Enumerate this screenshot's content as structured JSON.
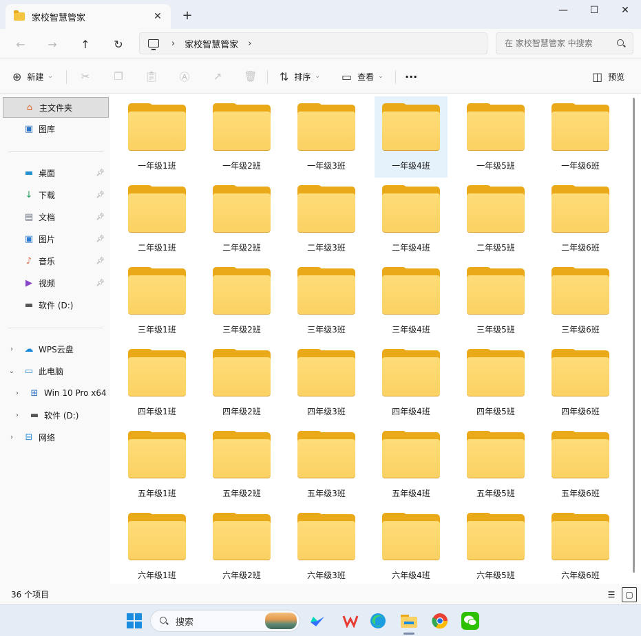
{
  "window": {
    "tab_title": "家校智慧管家",
    "new_tab": "+",
    "close_tab": "✕",
    "minimize": "—",
    "maximize": "☐",
    "close": "✕"
  },
  "navigation": {
    "back": "←",
    "forward": "→",
    "up": "↑",
    "refresh": "↻",
    "breadcrumb": [
      "家校智慧管家"
    ],
    "search_placeholder": "在 家校智慧管家 中搜索"
  },
  "toolbar": {
    "new_label": "新建",
    "sort_label": "排序",
    "view_label": "查看",
    "more_label": "···",
    "preview_label": "预览",
    "icons": [
      "cut-icon",
      "copy-icon",
      "paste-icon",
      "rename-icon",
      "share-icon",
      "delete-icon"
    ]
  },
  "sidebar": {
    "top_items": [
      {
        "label": "主文件夹",
        "icon": "home-icon",
        "selected": true
      },
      {
        "label": "图库",
        "icon": "gallery-icon"
      }
    ],
    "pinned_items": [
      {
        "label": "桌面",
        "icon": "desktop-icon",
        "pinned": true
      },
      {
        "label": "下载",
        "icon": "download-icon",
        "pinned": true
      },
      {
        "label": "文档",
        "icon": "document-icon",
        "pinned": true
      },
      {
        "label": "图片",
        "icon": "pictures-icon",
        "pinned": true
      },
      {
        "label": "音乐",
        "icon": "music-icon",
        "pinned": true
      },
      {
        "label": "视频",
        "icon": "video-icon",
        "pinned": true
      },
      {
        "label": "软件 (D:)",
        "icon": "drive-icon",
        "pinned": false
      }
    ],
    "tree_items": [
      {
        "label": "WPS云盘",
        "icon": "cloud-icon",
        "expander": "›",
        "indent": 0
      },
      {
        "label": "此电脑",
        "icon": "this-pc-icon",
        "expander": "⌄",
        "indent": 0
      },
      {
        "label": "Win 10 Pro x64",
        "icon": "windows-drive-icon",
        "expander": "›",
        "indent": 1
      },
      {
        "label": "软件 (D:)",
        "icon": "drive-icon",
        "expander": "›",
        "indent": 1
      },
      {
        "label": "网络",
        "icon": "network-icon",
        "expander": "›",
        "indent": 0
      }
    ]
  },
  "folders": [
    "一年级1班",
    "一年级2班",
    "一年级3班",
    "一年级4班",
    "一年级5班",
    "一年级6班",
    "二年级1班",
    "二年级2班",
    "二年级3班",
    "二年级4班",
    "二年级5班",
    "二年级6班",
    "三年级1班",
    "三年级2班",
    "三年级3班",
    "三年级4班",
    "三年级5班",
    "三年级6班",
    "四年级1班",
    "四年级2班",
    "四年级3班",
    "四年级4班",
    "四年级5班",
    "四年级6班",
    "五年级1班",
    "五年级2班",
    "五年级3班",
    "五年级4班",
    "五年级5班",
    "五年级6班",
    "六年级1班",
    "六年级2班",
    "六年级3班",
    "六年级4班",
    "六年级5班",
    "六年级6班"
  ],
  "selected_folder": "一年级4班",
  "status": {
    "item_count": "36 个项目"
  },
  "taskbar": {
    "search_label": "搜索",
    "apps": [
      "windows-start-icon",
      "lark-icon",
      "wps-icon",
      "edge-icon",
      "file-explorer-icon",
      "chrome-icon",
      "wechat-icon"
    ]
  },
  "colors": {
    "folder_front": "#fbd163",
    "folder_back": "#e9a918",
    "selection": "#e5f1fb",
    "accent": "#0067c0"
  }
}
